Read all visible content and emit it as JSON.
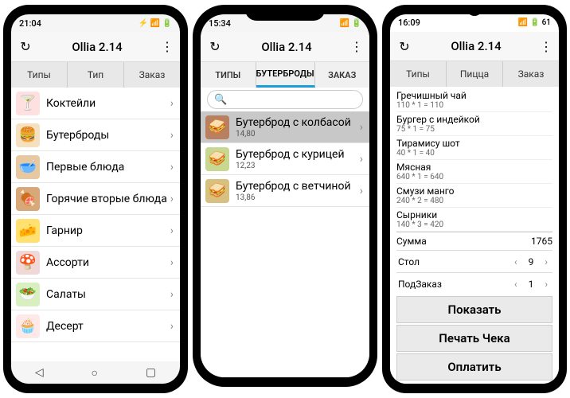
{
  "app_title": "Ollia 2.14",
  "phone_a": {
    "time": "21:04",
    "tabs": [
      "Типы",
      "Тип",
      "Заказ"
    ],
    "categories": [
      {
        "label": "Коктейли",
        "emoji": "🍸",
        "bg": "#ffe0e0"
      },
      {
        "label": "Бутерброды",
        "emoji": "🍔",
        "bg": "#f5e0c0"
      },
      {
        "label": "Первые блюда",
        "emoji": "🥣",
        "bg": "#e8c8a0"
      },
      {
        "label": "Горячие вторые блюда",
        "emoji": "🍖",
        "bg": "#d8a878"
      },
      {
        "label": "Гарнир",
        "emoji": "🧀",
        "bg": "#ffe070"
      },
      {
        "label": "Ассорти",
        "emoji": "🍄",
        "bg": "#f0d8d8"
      },
      {
        "label": "Салаты",
        "emoji": "🥗",
        "bg": "#d8f0c0"
      },
      {
        "label": "Десерт",
        "emoji": "🧁",
        "bg": "#ffe8e8"
      }
    ]
  },
  "phone_b": {
    "time": "15:34",
    "tabs": [
      "ТИПЫ",
      "БУТЕРБРОДЫ",
      "ЗАКАЗ"
    ],
    "active_tab": 1,
    "items": [
      {
        "label": "Бутерброд с колбасой",
        "price": "14,80",
        "sel": true,
        "bg": "#b88060"
      },
      {
        "label": "Бутерброд с курицей",
        "price": "12,23",
        "sel": false,
        "bg": "#c8d890"
      },
      {
        "label": "Бутерброд с ветчиной",
        "price": "13,86",
        "sel": false,
        "bg": "#d8c080"
      }
    ]
  },
  "phone_c": {
    "time": "16:09",
    "tabs": [
      "Типы",
      "Пицца",
      "Заказ"
    ],
    "order": [
      {
        "name": "Гречишный чай",
        "calc": "110 * 1 = 110"
      },
      {
        "name": "Бургер с индейкой",
        "calc": "75 * 1 = 75"
      },
      {
        "name": "Тирамису шот",
        "calc": "40 * 1 = 40"
      },
      {
        "name": "Мясная",
        "calc": "640 * 1 = 640"
      },
      {
        "name": "Смузи манго",
        "calc": "240 * 2 = 480"
      },
      {
        "name": "Сырники",
        "calc": "140 * 3 = 420"
      }
    ],
    "sum_label": "Сумма",
    "sum_value": "1765",
    "table_label": "Стол",
    "table_value": "9",
    "suborder_label": "ПодЗаказ",
    "suborder_value": "1",
    "btn_show": "Показать",
    "btn_print": "Печать Чека",
    "btn_pay": "Оплатить"
  }
}
